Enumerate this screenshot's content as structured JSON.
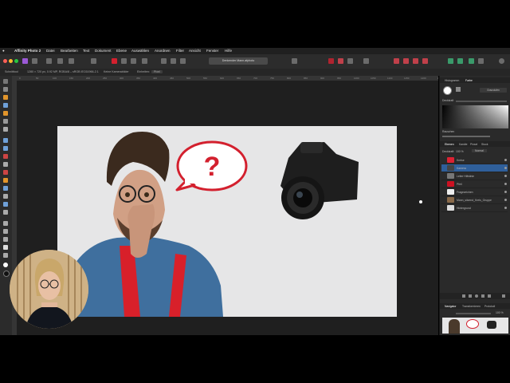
{
  "app": {
    "title": "Affinity Photo 2"
  },
  "menu": [
    "Datei",
    "Bearbeiten",
    "Text",
    "Dokument",
    "Ebene",
    "Auswählen",
    "Anordnen",
    "Filter",
    "Ansicht",
    "Fenster",
    "Hilfe"
  ],
  "toolbar": {
    "doc_tab": "Denkender Mann.afphoto"
  },
  "context_bar": {
    "tool": "Schnitttool",
    "doc_info": "1280 × 720 px, 0.92 MP, RGBA/8 – sRGB IEC61966-2.1",
    "items": [
      "Keine Kamerabilder",
      "Einheiten:",
      "Pixel"
    ]
  },
  "ruler": {
    "ticks": [
      "0",
      "50",
      "100",
      "150",
      "200",
      "250",
      "300",
      "350",
      "400",
      "450",
      "500",
      "550",
      "600",
      "650",
      "700",
      "750",
      "800",
      "850",
      "900",
      "950",
      "1000",
      "1050",
      "1100",
      "1150",
      "1200",
      "1250"
    ]
  },
  "canvas": {
    "speech_mark": "?"
  },
  "right_panel": {
    "top_tabs": [
      "Histogramm",
      "Farbe"
    ],
    "brush_label": "Graustufen",
    "opacity_label": "Deckkraft",
    "noise_label": "Rauschen",
    "layer_tabs": [
      "Ebenen",
      "Kanäle",
      "Pinsel",
      "Stock"
    ],
    "blend_label": "Deckkraft:",
    "blend_value": "100 %",
    "blend_mode": "Normal",
    "layers": [
      {
        "name": "Kreise",
        "thumb": "#dd2233"
      },
      {
        "name": "Kamera",
        "thumb": "#444444"
      },
      {
        "name": "Leiter Hilfslinie",
        "thumb": "#777777"
      },
      {
        "name": "Pfeil",
        "thumb": "#cc1122"
      },
      {
        "name": "Fragezeichen",
        "thumb": "#eeeeee"
      },
      {
        "name": "Mann_sitzend_Kreis_Gruppe",
        "thumb": "#8a6a4a"
      },
      {
        "name": "Hintergrund",
        "thumb": "#dddddd"
      }
    ],
    "nav_tabs": [
      "Navigator",
      "Transformieren",
      "Protokoll"
    ],
    "zoom_value": "100 %"
  },
  "colors": {
    "accent": "#3a7fd5",
    "red": "#d3202e",
    "menubar": "#202020"
  }
}
